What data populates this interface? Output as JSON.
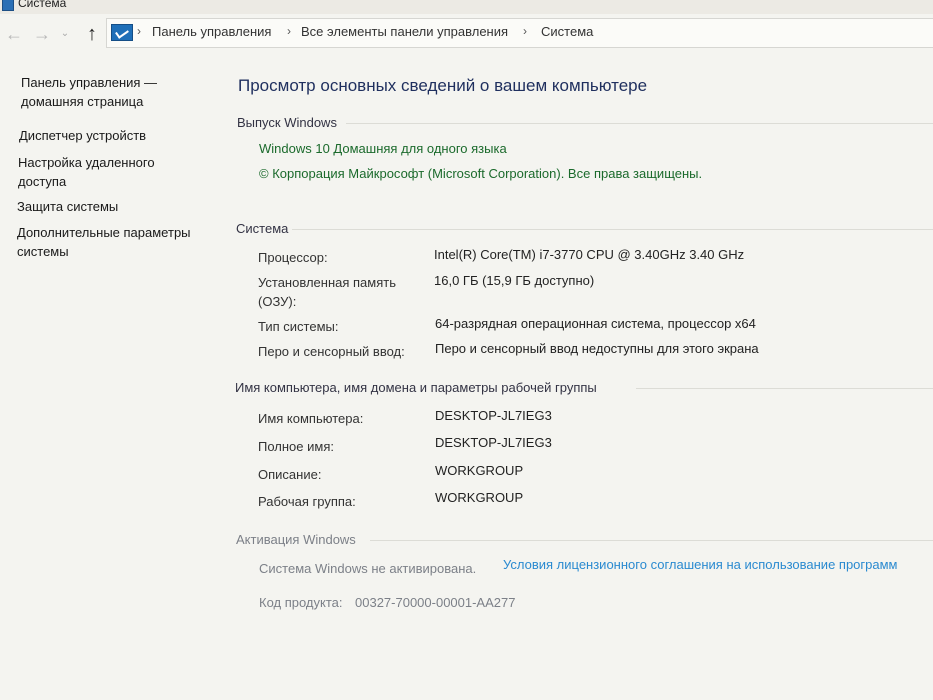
{
  "window": {
    "title": "Система"
  },
  "address": {
    "crumbs": [
      "Панель управления",
      "Все элементы панели управления",
      "Система"
    ]
  },
  "sidebar": {
    "home": "Панель управления — домашняя страница",
    "items": [
      "Диспетчер устройств",
      "Настройка удаленного доступа",
      "Защита системы",
      "Дополнительные параметры системы"
    ]
  },
  "main": {
    "title": "Просмотр основных сведений о вашем компьютере",
    "edition": {
      "header": "Выпуск Windows",
      "name": "Windows 10 Домашняя для одного языка",
      "copyright": "© Корпорация Майкрософт (Microsoft Corporation). Все права защищены."
    },
    "system": {
      "header": "Система",
      "rows": [
        {
          "label": "Процессор:",
          "value": "Intel(R) Core(TM) i7-3770 CPU @ 3.40GHz   3.40 GHz"
        },
        {
          "label": "Установленная память (ОЗУ):",
          "value": "16,0 ГБ (15,9 ГБ доступно)"
        },
        {
          "label": "Тип системы:",
          "value": "64-разрядная операционная система, процессор x64"
        },
        {
          "label": "Перо и сенсорный ввод:",
          "value": "Перо и сенсорный ввод недоступны для этого экрана"
        }
      ]
    },
    "computer": {
      "header": "Имя компьютера, имя домена и параметры рабочей группы",
      "rows": [
        {
          "label": "Имя компьютера:",
          "value": "DESKTOP-JL7IEG3"
        },
        {
          "label": "Полное имя:",
          "value": "DESKTOP-JL7IEG3"
        },
        {
          "label": "Описание:",
          "value": "WORKGROUP"
        },
        {
          "label": "Рабочая группа:",
          "value": "WORKGROUP"
        }
      ]
    },
    "activation": {
      "header": "Активация Windows",
      "status": "Система Windows не активирована.",
      "license_link": "Условия лицензионного соглашения на использование программ",
      "product_key_label": "Код продукта:",
      "product_key": "00327-70000-00001-AA277"
    }
  },
  "icons": {
    "back": "←",
    "forward": "→",
    "recent": "⌄",
    "up": "↑",
    "sep": "›"
  },
  "colors": {
    "edition_green": "#1b6a2c",
    "link_blue": "#2a8ad0",
    "title_navy": "#1f2f5e"
  }
}
